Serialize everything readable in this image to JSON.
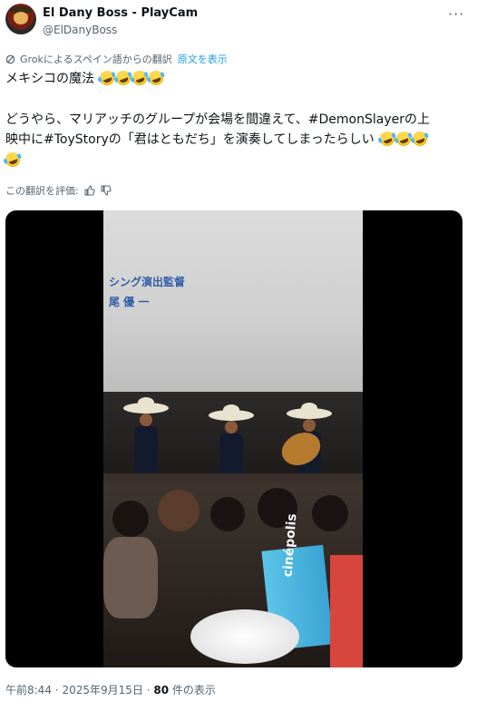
{
  "author": {
    "display_name": "El Dany Boss - PlayCam",
    "handle": "@ElDanyBoss",
    "avatar_icon": "avatar-image",
    "more_icon": "more-options-icon"
  },
  "translation": {
    "notice": "Grokによるスペイン語からの翻訳",
    "show_original": "原文を表示"
  },
  "post": {
    "line1": "メキシコの魔法",
    "line2": "どうやら、マリアッチのグループが会場を間違えて、#DemonSlayerの上",
    "line3": "映中に#ToyStoryの「君はともだち」を演奏してしまったらしい",
    "emoji_name": "rolling-on-floor-laughing-emoji",
    "line1_emoji_count": 4,
    "line3_emoji_count": 3,
    "line4_emoji_count": 1
  },
  "rate": {
    "label": "この翻訳を評価:",
    "thumbs_up_icon": "thumbs-up-icon",
    "thumbs_down_icon": "thumbs-down-icon"
  },
  "video": {
    "credit_line1": "シング演出監督",
    "credit_line2": "尾 優 一",
    "cup_brand": "cinépolis"
  },
  "footer": {
    "time": "午前8:44",
    "sep1": "·",
    "date": "2025年9月15日",
    "sep2": "·",
    "views_count": "80",
    "views_label": "件の表示"
  },
  "colors": {
    "link": "#1d9bf0",
    "secondary_text": "#536471",
    "primary_text": "#0f1419"
  }
}
